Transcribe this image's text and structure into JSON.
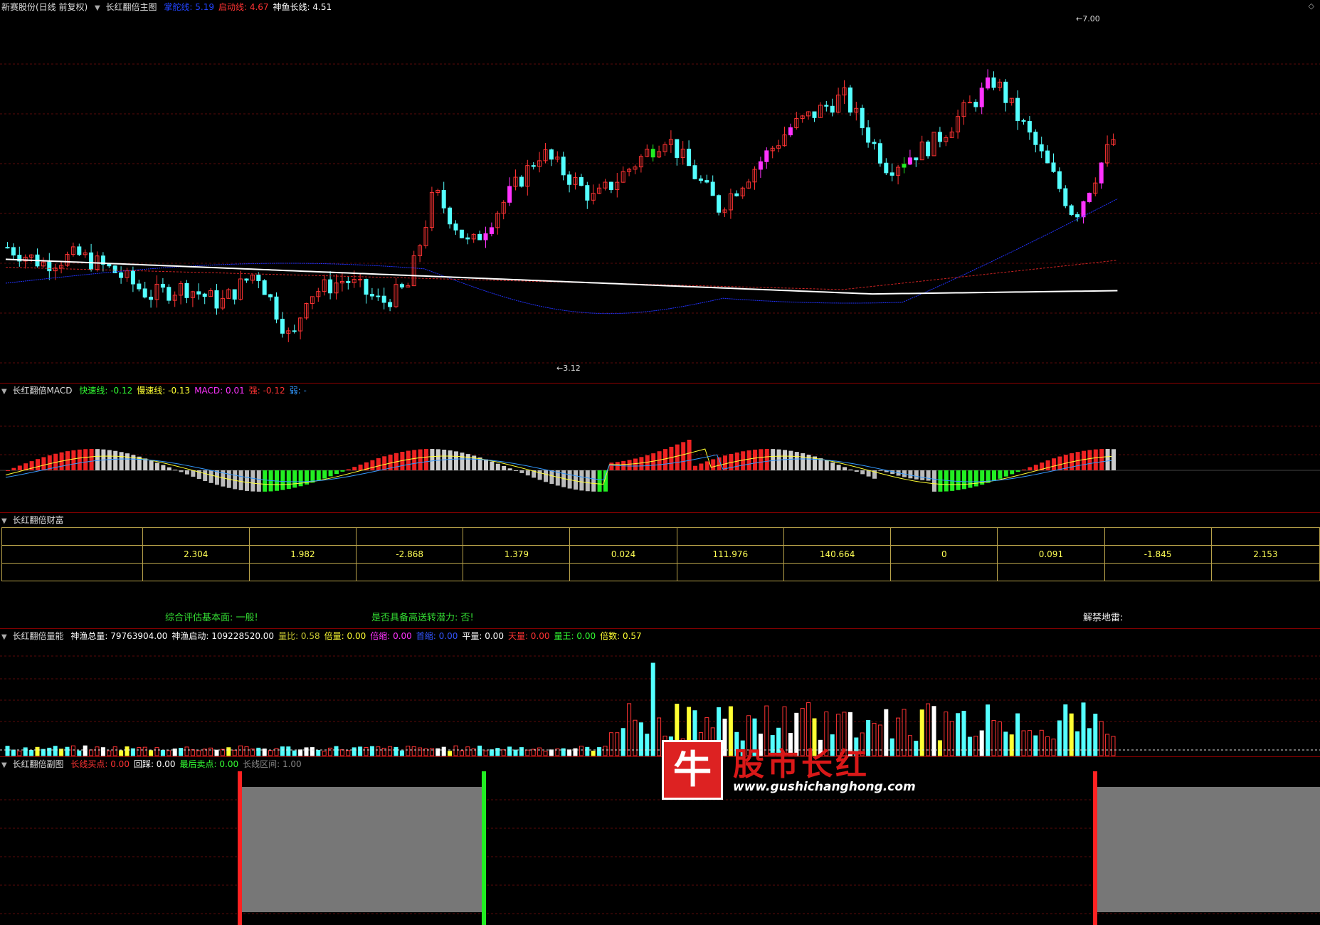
{
  "main_panel": {
    "stock": "新赛股份(日线 前复权)",
    "indicator": "长红翻倍主图",
    "fields": [
      {
        "label": "掌舵线: 5.19",
        "color": "#2244ff"
      },
      {
        "label": "启动线: 4.67",
        "color": "#ff3333"
      },
      {
        "label": "神鱼长线: 4.51",
        "color": "#ffffff"
      }
    ],
    "high_label": "7.00",
    "low_label": "3.12"
  },
  "macd_panel": {
    "indicator": "长红翻倍MACD",
    "fields": [
      {
        "label": "快速线: -0.12",
        "color": "#33ff33"
      },
      {
        "label": "慢速线: -0.13",
        "color": "#ffff33"
      },
      {
        "label": "MACD: 0.01",
        "color": "#ff33ff"
      },
      {
        "label": "强: -0.12",
        "color": "#ff3333"
      },
      {
        "label": "弱: -",
        "color": "#3399ff"
      }
    ]
  },
  "wealth_panel": {
    "indicator": "长红翻倍财富",
    "rows": [
      [
        "",
        "",
        "",
        "",
        "",
        "",
        "",
        "",
        "",
        "",
        "",
        "",
        ""
      ],
      [
        "",
        "2.304",
        "1.982",
        "-2.868",
        "1.379",
        "0.024",
        "111.976",
        "140.664",
        "0",
        "0.091",
        "-1.845",
        "2.153"
      ],
      [
        "",
        "",
        "",
        "",
        "",
        "",
        "",
        "",
        "",
        "",
        "",
        ""
      ]
    ],
    "eval_fundamental": "综合评估基本面: 一般!",
    "eval_potential": "是否具备高送转潜力: 否!",
    "eval_mine": "解禁地雷:"
  },
  "volume_panel": {
    "indicator": "长红翻倍量能",
    "fields": [
      {
        "label": "神渔总量: 79763904.00",
        "color": "#ffffff"
      },
      {
        "label": "神渔启动: 109228520.00",
        "color": "#ffffff"
      },
      {
        "label": "量比: 0.58",
        "color": "#cccc33"
      },
      {
        "label": "倍量: 0.00",
        "color": "#ffff33"
      },
      {
        "label": "倍缩: 0.00",
        "color": "#ff33ff"
      },
      {
        "label": "首缩: 0.00",
        "color": "#3355ff"
      },
      {
        "label": "平量: 0.00",
        "color": "#ffffff"
      },
      {
        "label": "天量: 0.00",
        "color": "#ff3333"
      },
      {
        "label": "量王: 0.00",
        "color": "#33ff33"
      },
      {
        "label": "倍数: 0.57",
        "color": "#ffff33"
      }
    ]
  },
  "sub_panel": {
    "indicator": "长红翻倍副图",
    "fields": [
      {
        "label": "长线买点: 0.00",
        "color": "#ff3333"
      },
      {
        "label": "回踩: 0.00",
        "color": "#ffffff"
      },
      {
        "label": "最后卖点: 0.00",
        "color": "#33ff33"
      },
      {
        "label": "长线区间: 1.00",
        "color": "#888888"
      }
    ]
  },
  "watermark": {
    "logo_char": "牛",
    "title": "股市长红",
    "url": "www.gushichanghong.com"
  },
  "colors": {
    "up": "#ff3333",
    "down": "#54ffff",
    "magenta": "#ff33ff",
    "green": "#22ee22"
  }
}
